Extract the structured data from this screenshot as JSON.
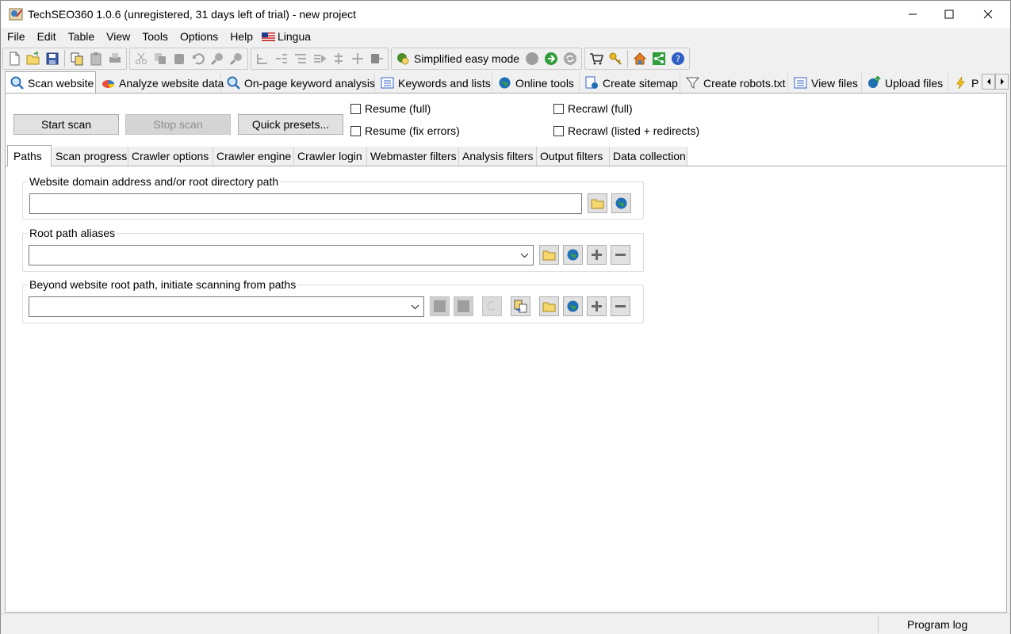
{
  "window": {
    "title": "TechSEO360 1.0.6 (unregistered, 31 days left of trial) - new project"
  },
  "menu": {
    "items": [
      "File",
      "Edit",
      "Table",
      "View",
      "Tools",
      "Options",
      "Help"
    ],
    "lingua": "Lingua"
  },
  "toolbar": {
    "simplified_mode": "Simplified easy mode"
  },
  "main_tabs": [
    {
      "label": "Scan website",
      "icon": "scan-website-icon"
    },
    {
      "label": "Analyze website data",
      "icon": "analyze-icon"
    },
    {
      "label": "On-page keyword analysis",
      "icon": "keyword-analysis-icon"
    },
    {
      "label": "Keywords and lists",
      "icon": "list-icon"
    },
    {
      "label": "Online tools",
      "icon": "globe-icon"
    },
    {
      "label": "Create sitemap",
      "icon": "sitemap-icon"
    },
    {
      "label": "Create robots.txt",
      "icon": "filter-icon"
    },
    {
      "label": "View files",
      "icon": "list-icon"
    },
    {
      "label": "Upload files",
      "icon": "upload-globe-icon"
    },
    {
      "label": "P",
      "icon": "lightning-icon"
    }
  ],
  "scan": {
    "start_label": "Start scan",
    "stop_label": "Stop scan",
    "presets_label": "Quick presets...",
    "resume_full": "Resume (full)",
    "resume_fix": "Resume (fix errors)",
    "recrawl_full": "Recrawl (full)",
    "recrawl_listed": "Recrawl (listed + redirects)"
  },
  "sub_tabs": [
    "Paths",
    "Scan progress",
    "Crawler options",
    "Crawler engine",
    "Crawler login",
    "Webmaster filters",
    "Analysis filters",
    "Output filters",
    "Data collection"
  ],
  "paths": {
    "domain_label": "Website domain address and/or root directory path",
    "domain_value": "",
    "aliases_label": "Root path aliases",
    "aliases_value": "",
    "beyond_label": "Beyond website root path, initiate scanning from paths",
    "beyond_value": ""
  },
  "status": {
    "program_log": "Program log"
  }
}
